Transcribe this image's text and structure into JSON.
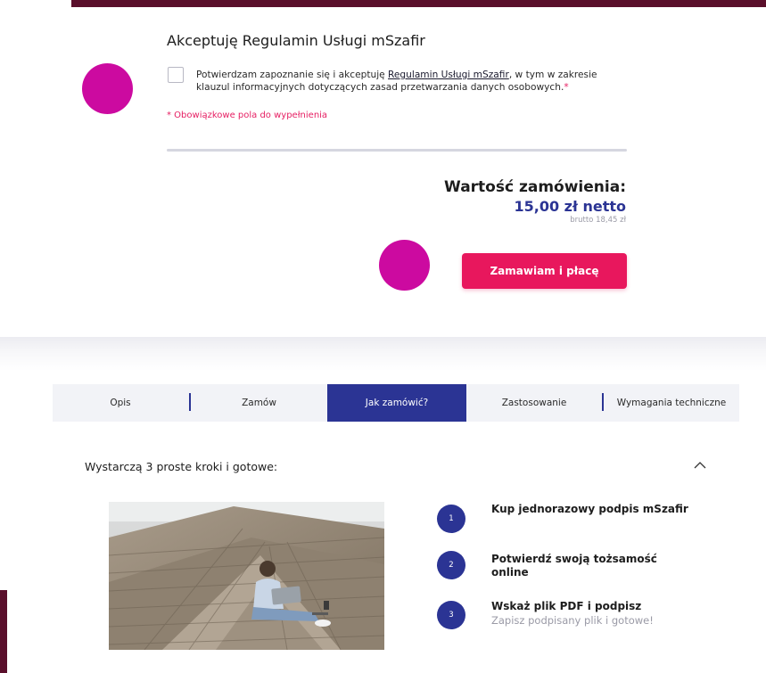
{
  "terms": {
    "title": "Akceptuję Regulamin Usługi mSzafir",
    "consent_prefix": "Potwierdzam zapoznanie się i akceptuję ",
    "consent_link": "Regulamin Usługi mSzafir",
    "consent_suffix": ", w tym w zakresie klauzul informacyjnych dotyczących zasad przetwarzania danych osobowych.",
    "required_mark": "*",
    "required_note": "* Obowiązkowe pola do wypełnienia"
  },
  "order": {
    "label": "Wartość zamówienia:",
    "net": "15,00 zł netto",
    "gross": "brutto 18,45 zł",
    "pay_button": "Zamawiam i płacę"
  },
  "tabs": [
    {
      "label": "Opis"
    },
    {
      "label": "Zamów"
    },
    {
      "label": "Jak zamówić?"
    },
    {
      "label": "Zastosowanie"
    },
    {
      "label": "Wymagania techniczne"
    }
  ],
  "active_tab": "Jak zamówić?",
  "steps_section": {
    "title": "Wystarczą 3 proste kroki i gotowe:",
    "steps": [
      {
        "num": "1",
        "title": "Kup jednorazowy podpis mSzafir",
        "subtitle": ""
      },
      {
        "num": "2",
        "title_line1": "Potwierdź swoją tożsamość",
        "title_line2": "online",
        "subtitle": ""
      },
      {
        "num": "3",
        "title": "Wskaż plik PDF i podpisz",
        "subtitle": "Zapisz podpisany plik i gotowe!"
      }
    ]
  },
  "colors": {
    "brand_dark": "#5a0f2b",
    "accent_pink": "#e8175d",
    "annotation_magenta": "#cc0aa0",
    "navy": "#2b3494"
  }
}
